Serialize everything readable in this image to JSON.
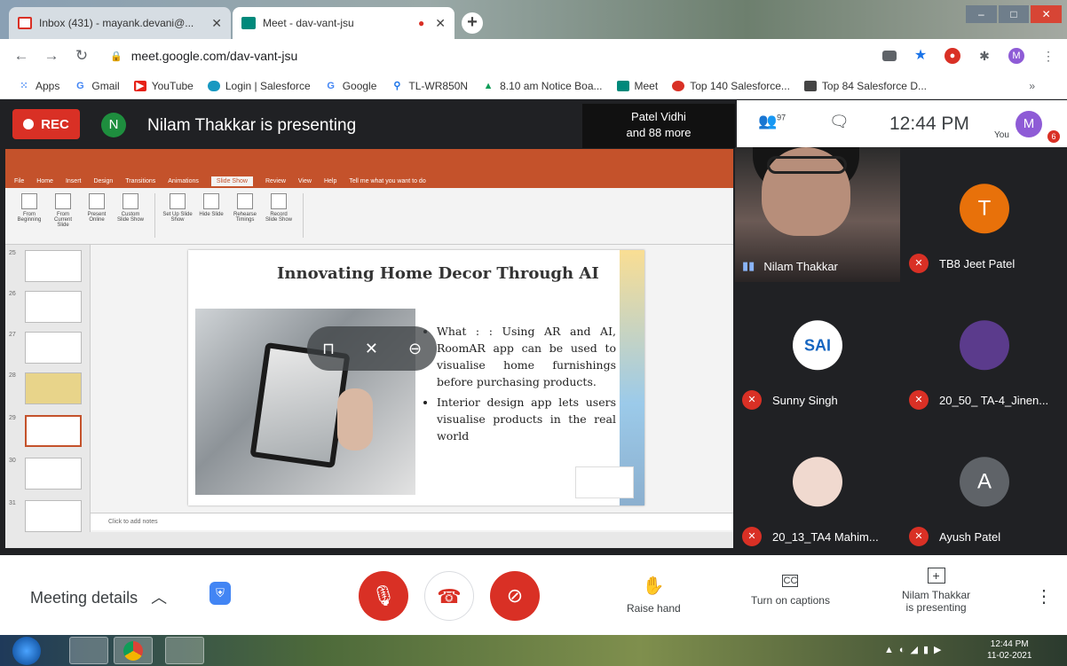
{
  "browser": {
    "tabs": [
      {
        "title": "Inbox (431) - mayank.devani@...",
        "active": false
      },
      {
        "title": "Meet - dav-vant-jsu",
        "active": true
      }
    ],
    "url": "meet.google.com/dav-vant-jsu",
    "profile_initial": "M",
    "bookmarks": [
      "Apps",
      "Gmail",
      "YouTube",
      "Login | Salesforce",
      "Google",
      "TL-WR850N",
      "8.10 am Notice Boa...",
      "Meet",
      "Top 140 Salesforce...",
      "Top 84 Salesforce D..."
    ]
  },
  "meet": {
    "rec_label": "REC",
    "presenter_initial": "N",
    "presenting_text": "Nilam Thakkar is presenting",
    "pinned_line1": "Patel Vidhi",
    "pinned_line2": "and 88 more",
    "people_count": "97",
    "time": "12:44 PM",
    "you_label": "You",
    "you_initial": "M",
    "notif_count": "6",
    "participants": [
      {
        "name": "Nilam Thakkar",
        "initial": "",
        "muted": false,
        "avatar_color": "#b78e7a"
      },
      {
        "name": "TB8 Jeet Patel",
        "initial": "T",
        "muted": true,
        "avatar_color": "#e8710a"
      },
      {
        "name": "Sunny Singh",
        "initial": "SAI",
        "muted": true,
        "avatar_color": "#1565c0"
      },
      {
        "name": "20_50_ TA-4_Jinen...",
        "initial": "",
        "muted": true,
        "avatar_color": "#5b3b8c"
      },
      {
        "name": "20_13_TA4 Mahim...",
        "initial": "",
        "muted": true,
        "avatar_color": "#f0d9cf"
      },
      {
        "name": "Ayush Patel",
        "initial": "A",
        "muted": true,
        "avatar_color": "#5f6368"
      }
    ],
    "controls": {
      "meeting_details": "Meeting details",
      "raise_hand": "Raise hand",
      "captions": "Turn on captions",
      "presenting_line1": "Nilam Thakkar",
      "presenting_line2": "is presenting"
    }
  },
  "ppt": {
    "menu": [
      "File",
      "Home",
      "Insert",
      "Design",
      "Transitions",
      "Animations",
      "Slide Show",
      "Review",
      "View",
      "Help",
      "Tell me what you want to do"
    ],
    "active_menu": "Slide Show",
    "ribbon_buttons": [
      "From Beginning",
      "From Current Slide",
      "Present Online",
      "Custom Slide Show",
      "Set Up Slide Show",
      "Hide Slide",
      "Rehearse Timings",
      "Record Slide Show"
    ],
    "slide_numbers": [
      "25",
      "26",
      "27",
      "28",
      "29",
      "30",
      "31"
    ],
    "notes_placeholder": "Click to add notes",
    "slide": {
      "title": "Innovating Home Decor Through AI",
      "bullets": [
        "What : : Using AR and AI, RoomAR app can be used to visualise home furnishings before purchasing products.",
        "Interior design app lets users visualise products in the real world"
      ]
    }
  },
  "taskbar": {
    "time": "12:44 PM",
    "date": "11-02-2021"
  }
}
